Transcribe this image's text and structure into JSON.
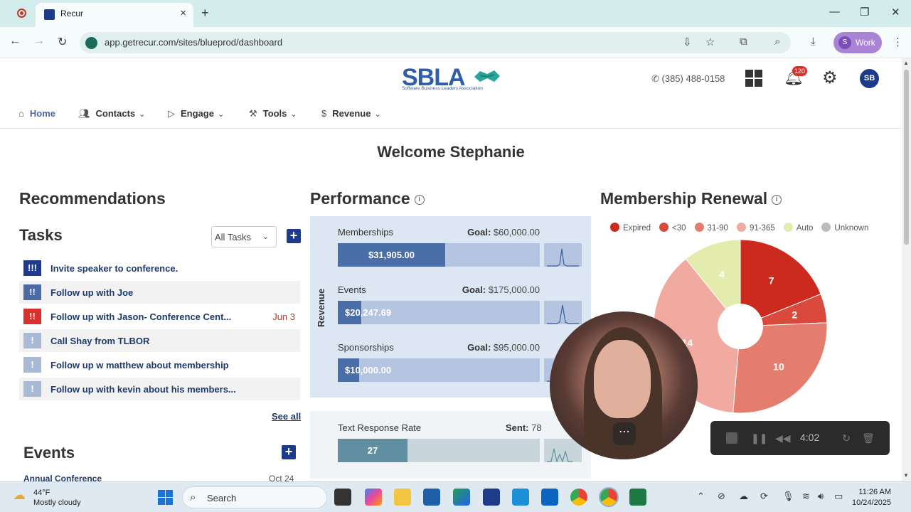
{
  "browser": {
    "tab_title": "Recur",
    "url": "app.getrecur.com/sites/blueprod/dashboard",
    "profile_initial": "S",
    "profile_label": "Work"
  },
  "header": {
    "logo_text": "SBLA",
    "logo_sub": "Software Business Leaders Association",
    "phone": "(385) 488-0158",
    "notification_count": "120",
    "user_initials": "SB"
  },
  "nav": {
    "home": "Home",
    "contacts": "Contacts",
    "engage": "Engage",
    "tools": "Tools",
    "revenue": "Revenue"
  },
  "welcome": "Welcome Stephanie",
  "recommendations": {
    "title": "Recommendations",
    "tasks_title": "Tasks",
    "filter": "All Tasks",
    "tasks": [
      {
        "priority": "!!!",
        "text": "Invite speaker to conference.",
        "date": "",
        "color": "#1e3a8a"
      },
      {
        "priority": "!!",
        "text": "Follow up with Joe",
        "date": "",
        "color": "#4b6aa6"
      },
      {
        "priority": "!!",
        "text": "Follow up with Jason- Conference Cent...",
        "date": "Jun 3",
        "color": "#d9302c"
      },
      {
        "priority": "!",
        "text": "Call Shay from TLBOR",
        "date": "",
        "color": "#a9bad6"
      },
      {
        "priority": "!",
        "text": "Follow up w matthew about membership",
        "date": "",
        "color": "#a9bad6"
      },
      {
        "priority": "!",
        "text": "Follow up with kevin about his members...",
        "date": "",
        "color": "#a9bad6"
      }
    ],
    "see_all": "See all"
  },
  "events": {
    "title": "Events",
    "first_event": "Annual Conference",
    "first_date": "Oct 24"
  },
  "performance": {
    "title": "Performance",
    "axis_label": "Revenue",
    "goal_label": "Goal:",
    "metrics": [
      {
        "name": "Memberships",
        "goal": "$60,000.00",
        "value": "$31,905.00",
        "fraction": 0.532
      },
      {
        "name": "Events",
        "goal": "$175,000.00",
        "value": "$20,247.69",
        "fraction": 0.116
      },
      {
        "name": "Sponsorships",
        "goal": "$95,000.00",
        "value": "$10,000.00",
        "fraction": 0.105
      }
    ],
    "text_response": {
      "name": "Text Response Rate",
      "sent_label": "Sent:",
      "sent": "78",
      "value": "27",
      "fraction": 0.346
    }
  },
  "membership_renewal": {
    "title": "Membership Renewal",
    "legend": [
      {
        "label": "Expired",
        "color": "#cc2a1e"
      },
      {
        "label": "<30",
        "color": "#da4a3c"
      },
      {
        "label": "31-90",
        "color": "#e57d6f"
      },
      {
        "label": "91-365",
        "color": "#f0aaa0"
      },
      {
        "label": "Auto",
        "color": "#e3ecac"
      },
      {
        "label": "Unknown",
        "color": "#bbbbbb"
      }
    ]
  },
  "chart_data": {
    "type": "pie",
    "title": "Membership Renewal",
    "categories": [
      "Expired",
      "<30",
      "31-90",
      "91-365",
      "Auto"
    ],
    "values": [
      7,
      2,
      10,
      14,
      4
    ],
    "colors": [
      "#cc2a1e",
      "#da4a3c",
      "#e57d6f",
      "#f0aaa0",
      "#e3ecac"
    ],
    "donut": true
  },
  "recorder": {
    "time": "4:02"
  },
  "taskbar": {
    "temp": "44°F",
    "weather": "Mostly cloudy",
    "search_placeholder": "Search",
    "time": "11:26 AM",
    "date": "10/24/2025"
  }
}
